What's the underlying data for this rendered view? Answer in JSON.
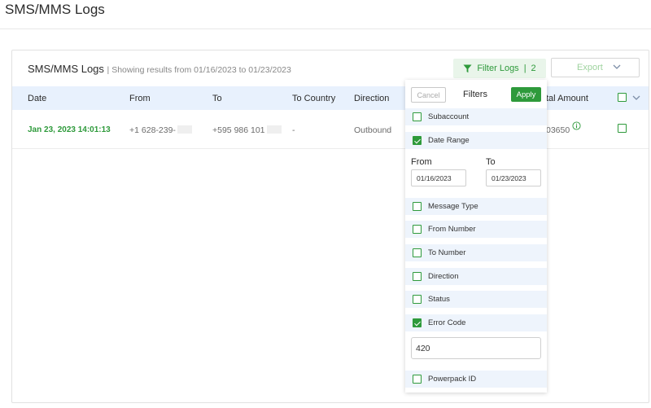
{
  "page": {
    "title": "SMS/MMS Logs"
  },
  "card": {
    "title": "SMS/MMS Logs",
    "subtitle": "| Showing results from 01/16/2023 to 01/23/2023",
    "filter_button": "Filter Logs",
    "filter_separator": "|",
    "filter_count": "2",
    "export_button": "Export"
  },
  "table": {
    "columns": {
      "date": "Date",
      "from": "From",
      "to": "To",
      "to_country": "To Country",
      "direction": "Direction",
      "total_amount": "tal Amount"
    },
    "rows": [
      {
        "date": "Jan 23, 2023 14:01:13",
        "from": "+1 628-239-",
        "to": "+595 986 101",
        "to_country": "-",
        "direction": "Outbound",
        "total_amount": "03650"
      }
    ]
  },
  "filters": {
    "cancel": "Cancel",
    "title": "Filters",
    "apply": "Apply",
    "items": [
      {
        "label": "Subaccount",
        "checked": false
      },
      {
        "label": "Date Range",
        "checked": true
      },
      {
        "label": "Message Type",
        "checked": false
      },
      {
        "label": "From Number",
        "checked": false
      },
      {
        "label": "To Number",
        "checked": false
      },
      {
        "label": "Direction",
        "checked": false
      },
      {
        "label": "Status",
        "checked": false
      },
      {
        "label": "Error Code",
        "checked": true
      },
      {
        "label": "Powerpack ID",
        "checked": false
      }
    ],
    "date_range": {
      "from_label": "From",
      "to_label": "To",
      "from_value": "01/16/2023",
      "to_value": "01/23/2023"
    },
    "error_code_value": "420"
  },
  "colors": {
    "accent": "#2e9a3b",
    "header_bg": "#e8f1fd",
    "filter_btn_bg": "#e9f5ea"
  }
}
